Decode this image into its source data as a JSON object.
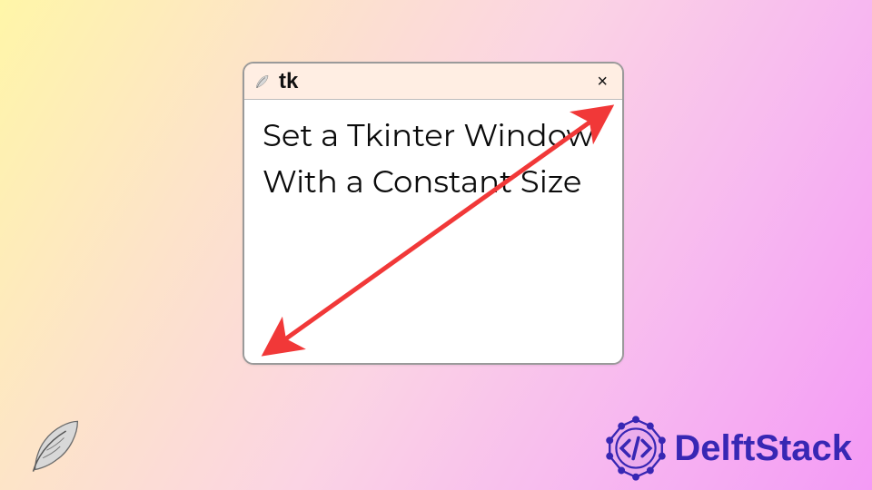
{
  "window": {
    "title": "tk",
    "content_text": "Set a Tkinter Window With a Constant Size",
    "close_glyph": "×"
  },
  "branding": {
    "name": "DelftStack"
  },
  "colors": {
    "arrow": "#f13838",
    "brand": "#3827b4",
    "titlebar_bg": "#ffeee3"
  },
  "icons": {
    "feather": "feather-icon",
    "close": "close-icon",
    "arrow": "resize-arrow-icon",
    "brand_emblem": "delftstack-emblem-icon"
  }
}
